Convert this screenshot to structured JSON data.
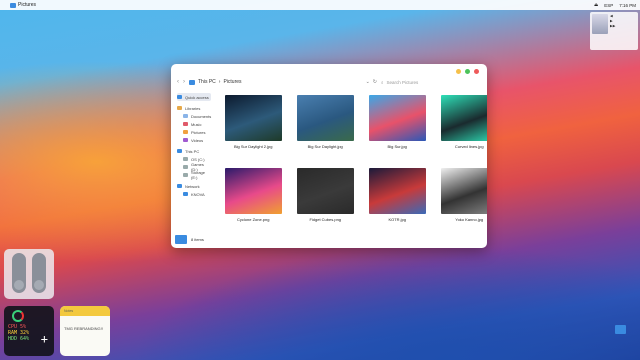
{
  "menubar": {
    "apple": "",
    "app_title": "Pictures",
    "right": [
      "⏏",
      "ESP",
      "7:16 PM"
    ]
  },
  "explorer": {
    "breadcrumb": [
      "This PC",
      "Pictures"
    ],
    "search_placeholder": "Search Pictures",
    "window_buttons": {
      "minimize_color": "#f5c04a",
      "maximize_color": "#4cc35a",
      "close_color": "#ee5a5a"
    },
    "sidebar": [
      {
        "label": "Quick access",
        "icon": "star-icon",
        "color": "#3a8be0",
        "level": 0,
        "active": true
      },
      {
        "label": "Libraries",
        "icon": "library-icon",
        "color": "#e7a94a",
        "level": 0
      },
      {
        "label": "Documents",
        "icon": "document-icon",
        "color": "#8ab4e8",
        "level": 1
      },
      {
        "label": "Music",
        "icon": "music-icon",
        "color": "#e05a6a",
        "level": 1
      },
      {
        "label": "Pictures",
        "icon": "pictures-icon",
        "color": "#f0a040",
        "level": 1
      },
      {
        "label": "Videos",
        "icon": "video-icon",
        "color": "#a05ad0",
        "level": 1
      },
      {
        "label": "This PC",
        "icon": "pc-icon",
        "color": "#3a8be0",
        "level": 0
      },
      {
        "label": "OS (C:)",
        "icon": "drive-icon",
        "color": "#9aa",
        "level": 1
      },
      {
        "label": "Games (D:)",
        "icon": "drive-icon",
        "color": "#9aa",
        "level": 1
      },
      {
        "label": "Storage (E:)",
        "icon": "drive-icon",
        "color": "#9aa",
        "level": 1
      },
      {
        "label": "Network",
        "icon": "network-icon",
        "color": "#3a8be0",
        "level": 0
      },
      {
        "label": "KNOVA",
        "icon": "computer-icon",
        "color": "#3a8be0",
        "level": 1
      }
    ],
    "files": [
      {
        "name": "Big Sur Daylight 2.jpg",
        "colors": [
          "#0c1a2e",
          "#2d5a7a",
          "#1e3a28"
        ]
      },
      {
        "name": "Big Sur Daylight.jpg",
        "colors": [
          "#4a7fb0",
          "#2a5880",
          "#3a6a4a"
        ]
      },
      {
        "name": "Big Sur.jpg",
        "colors": [
          "#3aa8e8",
          "#e8526a",
          "#2a58b8"
        ]
      },
      {
        "name": "Curved lines.jpg",
        "colors": [
          "#2ee0b8",
          "#1a2a2e",
          "#2ee0b8"
        ]
      },
      {
        "name": "Cyclone Zone.png",
        "colors": [
          "#2a1a6a",
          "#e84a8a",
          "#f0a030"
        ]
      },
      {
        "name": "Fidget Cubes.png",
        "colors": [
          "#2a2a2a",
          "#3a3a3a",
          "#2a2a2a"
        ]
      },
      {
        "name": "KOTR.jpg",
        "colors": [
          "#1a1a3a",
          "#c83a3a",
          "#3a6ab8"
        ]
      },
      {
        "name": "Yoko Kanno.jpg",
        "colors": [
          "#f0f0f0",
          "#333333",
          "#888888"
        ]
      }
    ],
    "status": "8 items"
  },
  "widgets": {
    "system": {
      "cpu": "CPU 5%",
      "ram": "RAM 32%",
      "hdd": "HDD 64%",
      "add": "+"
    },
    "note": {
      "header": "Notes",
      "body": "TMG REBRANDING!!"
    }
  }
}
